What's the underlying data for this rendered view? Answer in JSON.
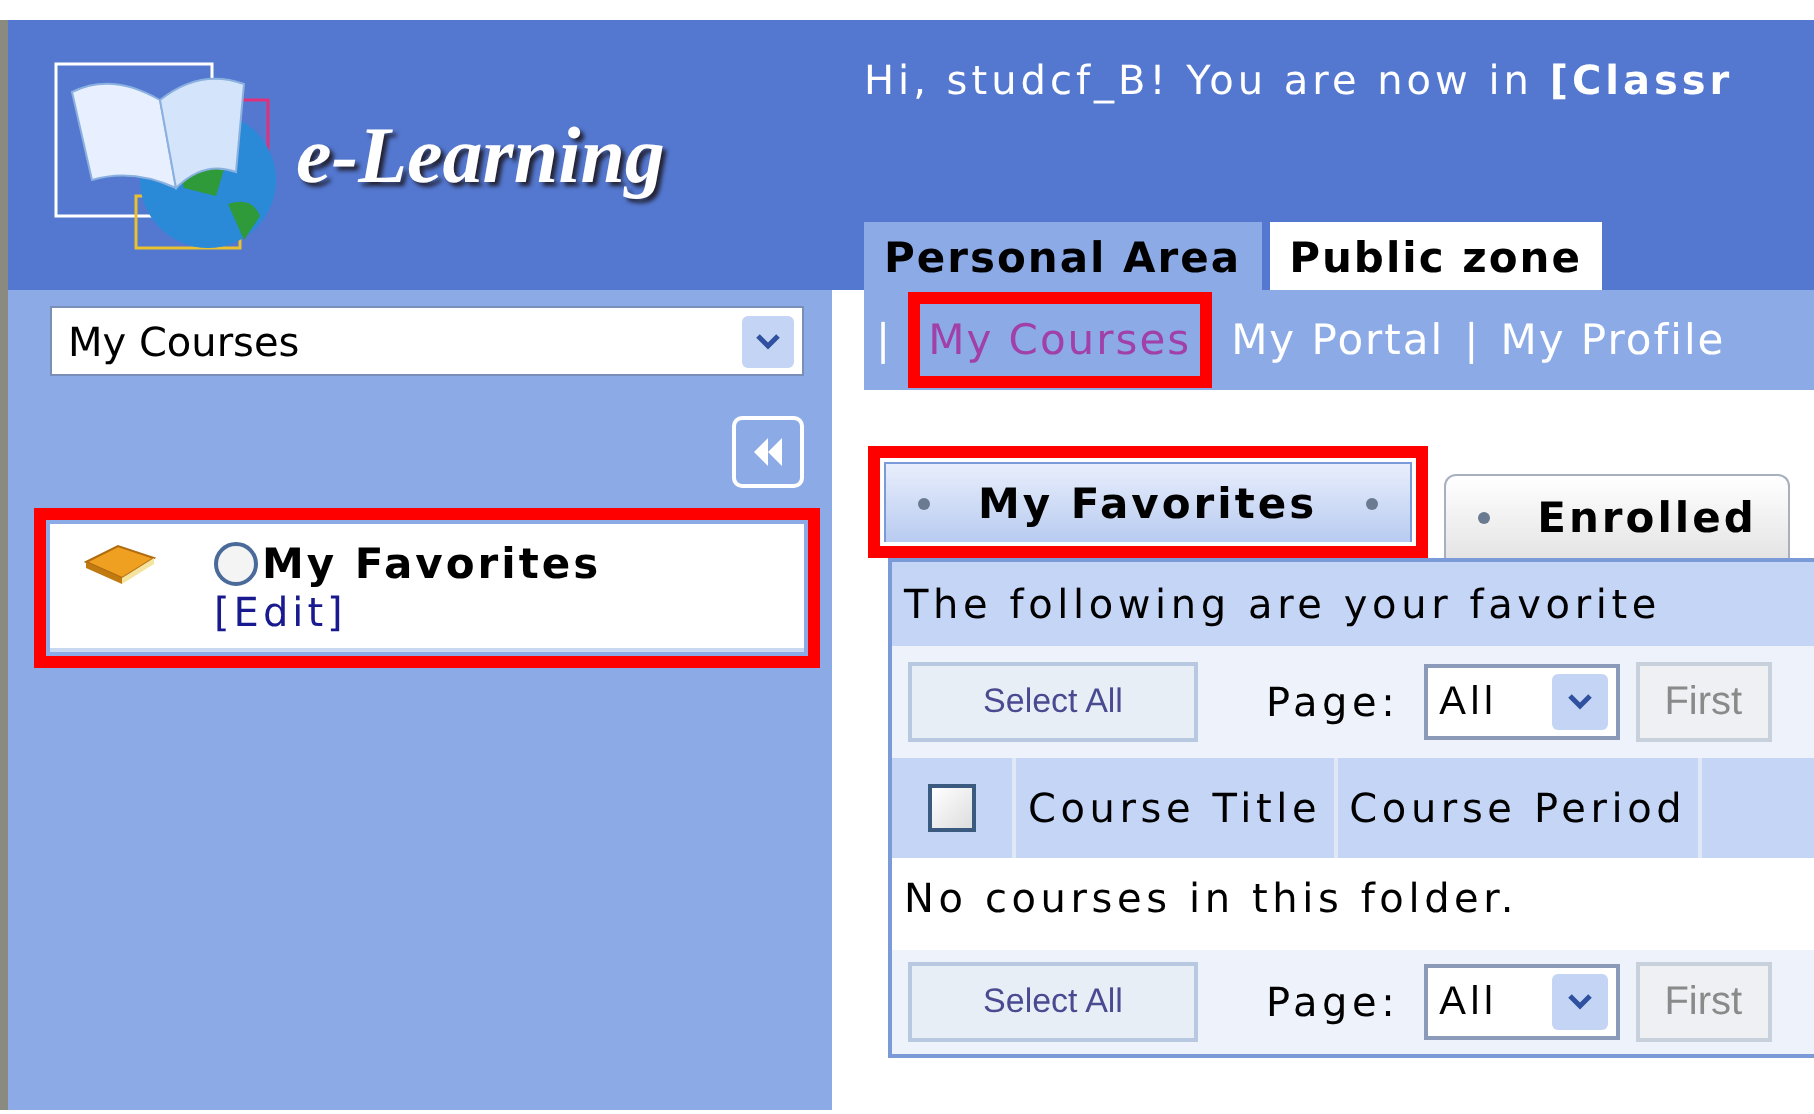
{
  "logo": {
    "text": "e-Learning"
  },
  "greeting": "Hi, studcf_B! You are now in **[Classr**",
  "area_tabs": [
    {
      "label": "Personal Area",
      "selected": true
    },
    {
      "label": "Public zone",
      "selected": false
    }
  ],
  "subnav": [
    {
      "kind": "separator",
      "label": "|"
    },
    {
      "kind": "link",
      "label": "My Courses",
      "selected": true,
      "highlighted": true
    },
    {
      "kind": "link",
      "label": "My Portal",
      "selected": false,
      "highlighted": false
    },
    {
      "kind": "separator",
      "label": "|"
    },
    {
      "kind": "link",
      "label": "My Profile",
      "selected": false,
      "highlighted": false
    }
  ],
  "sidebar": {
    "dropdown": {
      "value": "My Courses"
    },
    "folders": [
      {
        "label": "My Favorites",
        "action": "[Edit]",
        "selected": false,
        "highlighted": true
      }
    ]
  },
  "content_tabs": [
    {
      "label": "My Favorites",
      "selected": true,
      "highlighted": true
    },
    {
      "label": "Enrolled",
      "selected": false,
      "highlighted": false
    }
  ],
  "panel": {
    "description": "The following are your favorite",
    "toolbars": [
      {
        "select_all": "Select All",
        "page_label": "Page:",
        "page_value": "All",
        "first": {
          "label": "First",
          "disabled": true
        }
      },
      {
        "select_all": "Select All",
        "page_label": "Page:",
        "page_value": "All",
        "first": {
          "label": "First",
          "disabled": true
        }
      }
    ],
    "columns": [
      {
        "kind": "checkbox",
        "checked": false
      },
      {
        "kind": "text",
        "label": "Course Title"
      },
      {
        "kind": "text",
        "label": "Course Period"
      }
    ],
    "empty_message": "No courses in this folder."
  }
}
